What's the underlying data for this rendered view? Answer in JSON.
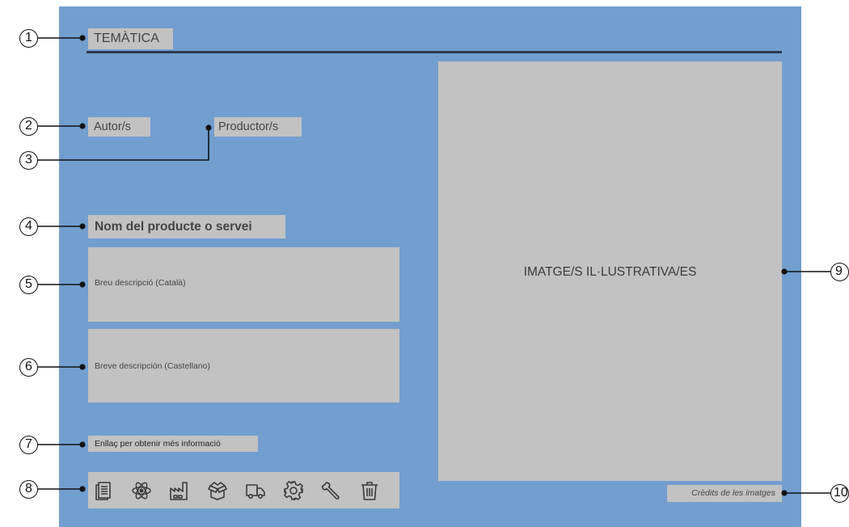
{
  "tematica": "TEMÀTICA",
  "autors": "Autor/s",
  "productors": "Productor/s",
  "nom_producte": "Nom del producte o servei",
  "descripcio_catala": "Breu descripció (Català)",
  "descripcio_castellano": "Breve descripción (Castellano)",
  "enllac": "Enllaç per obtenir més informació",
  "imatge": "IMATGE/S IL·LUSTRATIVA/ES",
  "credits": "Crèdits de les imatges",
  "icons": [
    "document-icon",
    "atom-icon",
    "factory-icon",
    "box-icon",
    "truck-icon",
    "gear-icon",
    "wrench-icon",
    "trash-icon"
  ],
  "callouts": [
    "1",
    "2",
    "3",
    "4",
    "5",
    "6",
    "7",
    "8",
    "9",
    "10"
  ],
  "colors": {
    "panel": "#729fcf",
    "box": "#c2c2c2",
    "rule": "#2e3a4e"
  }
}
